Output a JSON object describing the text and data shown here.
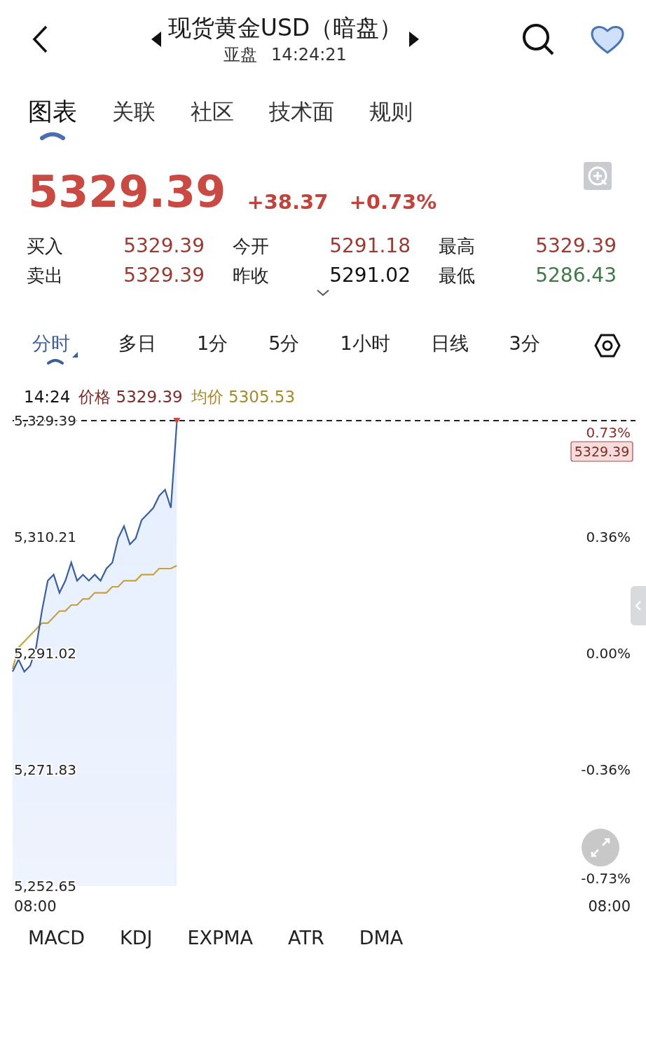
{
  "header": {
    "title": "现货黄金USD（暗盘）",
    "session": "亚盘",
    "time": "14:24:21"
  },
  "tabs": [
    {
      "label": "图表",
      "selected": true
    },
    {
      "label": "关联",
      "selected": false
    },
    {
      "label": "社区",
      "selected": false
    },
    {
      "label": "技术面",
      "selected": false
    },
    {
      "label": "规则",
      "selected": false
    }
  ],
  "quote": {
    "price": "5329.39",
    "change": "+38.37",
    "change_pct": "+0.73%"
  },
  "stats": [
    {
      "label": "买入",
      "value": "5329.39",
      "color": "#9a3b32"
    },
    {
      "label": "今开",
      "value": "5291.18",
      "color": "#9a3b32"
    },
    {
      "label": "最高",
      "value": "5329.39",
      "color": "#9a3b32"
    },
    {
      "label": "卖出",
      "value": "5329.39",
      "color": "#9a3b32"
    },
    {
      "label": "昨收",
      "value": "5291.02",
      "color": "#111111"
    },
    {
      "label": "最低",
      "value": "5286.43",
      "color": "#3f7a45"
    }
  ],
  "periods": [
    {
      "label": "分时",
      "selected": true
    },
    {
      "label": "多日",
      "selected": false
    },
    {
      "label": "1分",
      "selected": false
    },
    {
      "label": "5分",
      "selected": false
    },
    {
      "label": "1小时",
      "selected": false
    },
    {
      "label": "日线",
      "selected": false
    },
    {
      "label": "3分",
      "selected": false
    }
  ],
  "legend": {
    "time": "14:24",
    "items": [
      {
        "value": "5329.39",
        "color": "#7a2e2a"
      },
      {
        "value": "5305.53",
        "color": "#a58a2a"
      }
    ]
  },
  "chart": {
    "price_tag": "5329.39",
    "right_labels": [
      "0.73%",
      "0.36%",
      "0.00%",
      "-0.36%",
      "-0.73%"
    ],
    "chart_data": {
      "type": "line",
      "ylim": [
        5252.65,
        5329.39
      ],
      "yticks": [
        {
          "value": 5329.39,
          "label": "5,329.39"
        },
        {
          "value": 5310.21,
          "label": "5,310.21"
        },
        {
          "value": 5291.02,
          "label": "5,291.02"
        },
        {
          "value": 5271.83,
          "label": "5,271.83"
        },
        {
          "value": 5252.65,
          "label": "5,252.65"
        }
      ],
      "series": [
        {
          "name": "价格",
          "color": "#3a5f9e",
          "values": [
            5288,
            5290,
            5288,
            5289,
            5292,
            5298,
            5303,
            5304,
            5301,
            5303,
            5306,
            5303,
            5304,
            5303,
            5304,
            5303,
            5305,
            5306,
            5310,
            5312,
            5309,
            5310,
            5313,
            5314,
            5315,
            5317,
            5318,
            5315,
            5329,
            null,
            null,
            null,
            null,
            null,
            null,
            null,
            null,
            null,
            null,
            null,
            null,
            null,
            null,
            null,
            null,
            null,
            null,
            null,
            null,
            null,
            null,
            null,
            null,
            null,
            null,
            null,
            null,
            null,
            null,
            null,
            null,
            null,
            null,
            null,
            null,
            null,
            null,
            null,
            null,
            null,
            null,
            null,
            null,
            null,
            null,
            null,
            null,
            null,
            null,
            null,
            null,
            null,
            null,
            null,
            null,
            null,
            null,
            null,
            null,
            null,
            null,
            null,
            null,
            null,
            null,
            null,
            null,
            null,
            null,
            null,
            null,
            null,
            null,
            null,
            null,
            null,
            null
          ]
        },
        {
          "name": "均价",
          "color": "#c8a040",
          "values": [
            5288.5,
            5292,
            5293,
            5294,
            5295,
            5296,
            5296,
            5297,
            5298,
            5298,
            5299,
            5299,
            5300,
            5300,
            5301,
            5301,
            5301,
            5302,
            5302,
            5303,
            5303,
            5303,
            5304,
            5304,
            5304,
            5305,
            5305,
            5305,
            5305.5,
            null,
            null,
            null,
            null,
            null,
            null,
            null,
            null,
            null,
            null,
            null,
            null,
            null,
            null,
            null,
            null,
            null,
            null,
            null,
            null,
            null,
            null,
            null,
            null,
            null,
            null,
            null,
            null,
            null,
            null,
            null,
            null,
            null,
            null,
            null,
            null,
            null,
            null,
            null,
            null,
            null,
            null,
            null,
            null,
            null,
            null,
            null,
            null,
            null,
            null,
            null,
            null,
            null,
            null,
            null,
            null,
            null,
            null,
            null,
            null,
            null,
            null,
            null,
            null,
            null,
            null,
            null,
            null,
            null,
            null,
            null,
            null,
            null,
            null,
            null,
            null,
            null
          ]
        }
      ]
    },
    "time_labels": [
      "08:00",
      "08:00"
    ]
  },
  "indicators": [
    {
      "label": "MACD"
    },
    {
      "label": "KDJ"
    },
    {
      "label": "EXPMA"
    },
    {
      "label": "ATR"
    },
    {
      "label": "DMA"
    }
  ]
}
